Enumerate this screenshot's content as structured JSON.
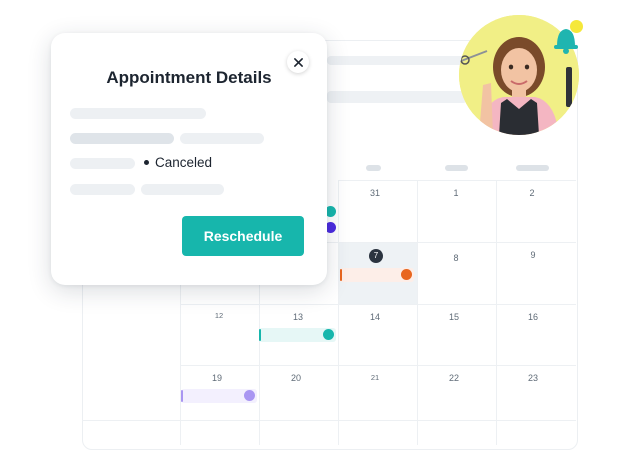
{
  "modal": {
    "title": "Appointment Details",
    "status_label": "Canceled",
    "reschedule_label": "Reschedule",
    "close_icon": "close-icon"
  },
  "calendar": {
    "row1": [
      "31",
      "1",
      "2"
    ],
    "row2": [
      "7",
      "8",
      "9"
    ],
    "row3": [
      "12",
      "13",
      "14",
      "15",
      "16"
    ],
    "row4": [
      "19",
      "20",
      "21",
      "22",
      "23"
    ]
  },
  "colors": {
    "accent": "#17b6ac",
    "orange": "#e8661f",
    "purple": "#a996f2",
    "indigo": "#4b2be0",
    "teal": "#17b6ac"
  },
  "icons": [
    "close-icon",
    "bell-icon",
    "avatar"
  ]
}
